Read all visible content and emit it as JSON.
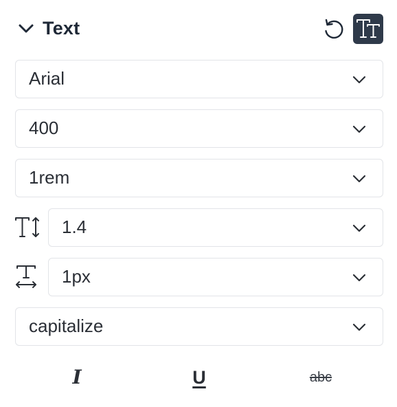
{
  "header": {
    "title": "Text",
    "collapse_icon": "chevron-down-icon",
    "reset_icon": "reset-icon",
    "typography_icon": "text-size-icon"
  },
  "fields": {
    "font_family": {
      "value": "Arial"
    },
    "font_weight": {
      "value": "400"
    },
    "font_size": {
      "value": "1rem"
    },
    "line_height": {
      "value": "1.4",
      "icon": "line-height-icon"
    },
    "letter_spacing": {
      "value": "1px",
      "icon": "letter-spacing-icon"
    },
    "text_transform": {
      "value": "capitalize"
    }
  },
  "style_buttons": {
    "italic": "I",
    "underline": "U",
    "strikethrough": "abc"
  },
  "colors": {
    "text": "#1f2937",
    "border": "#e2e4e8",
    "active_button_bg": "#2f3a4a",
    "active_button_fg": "#ffffff"
  }
}
